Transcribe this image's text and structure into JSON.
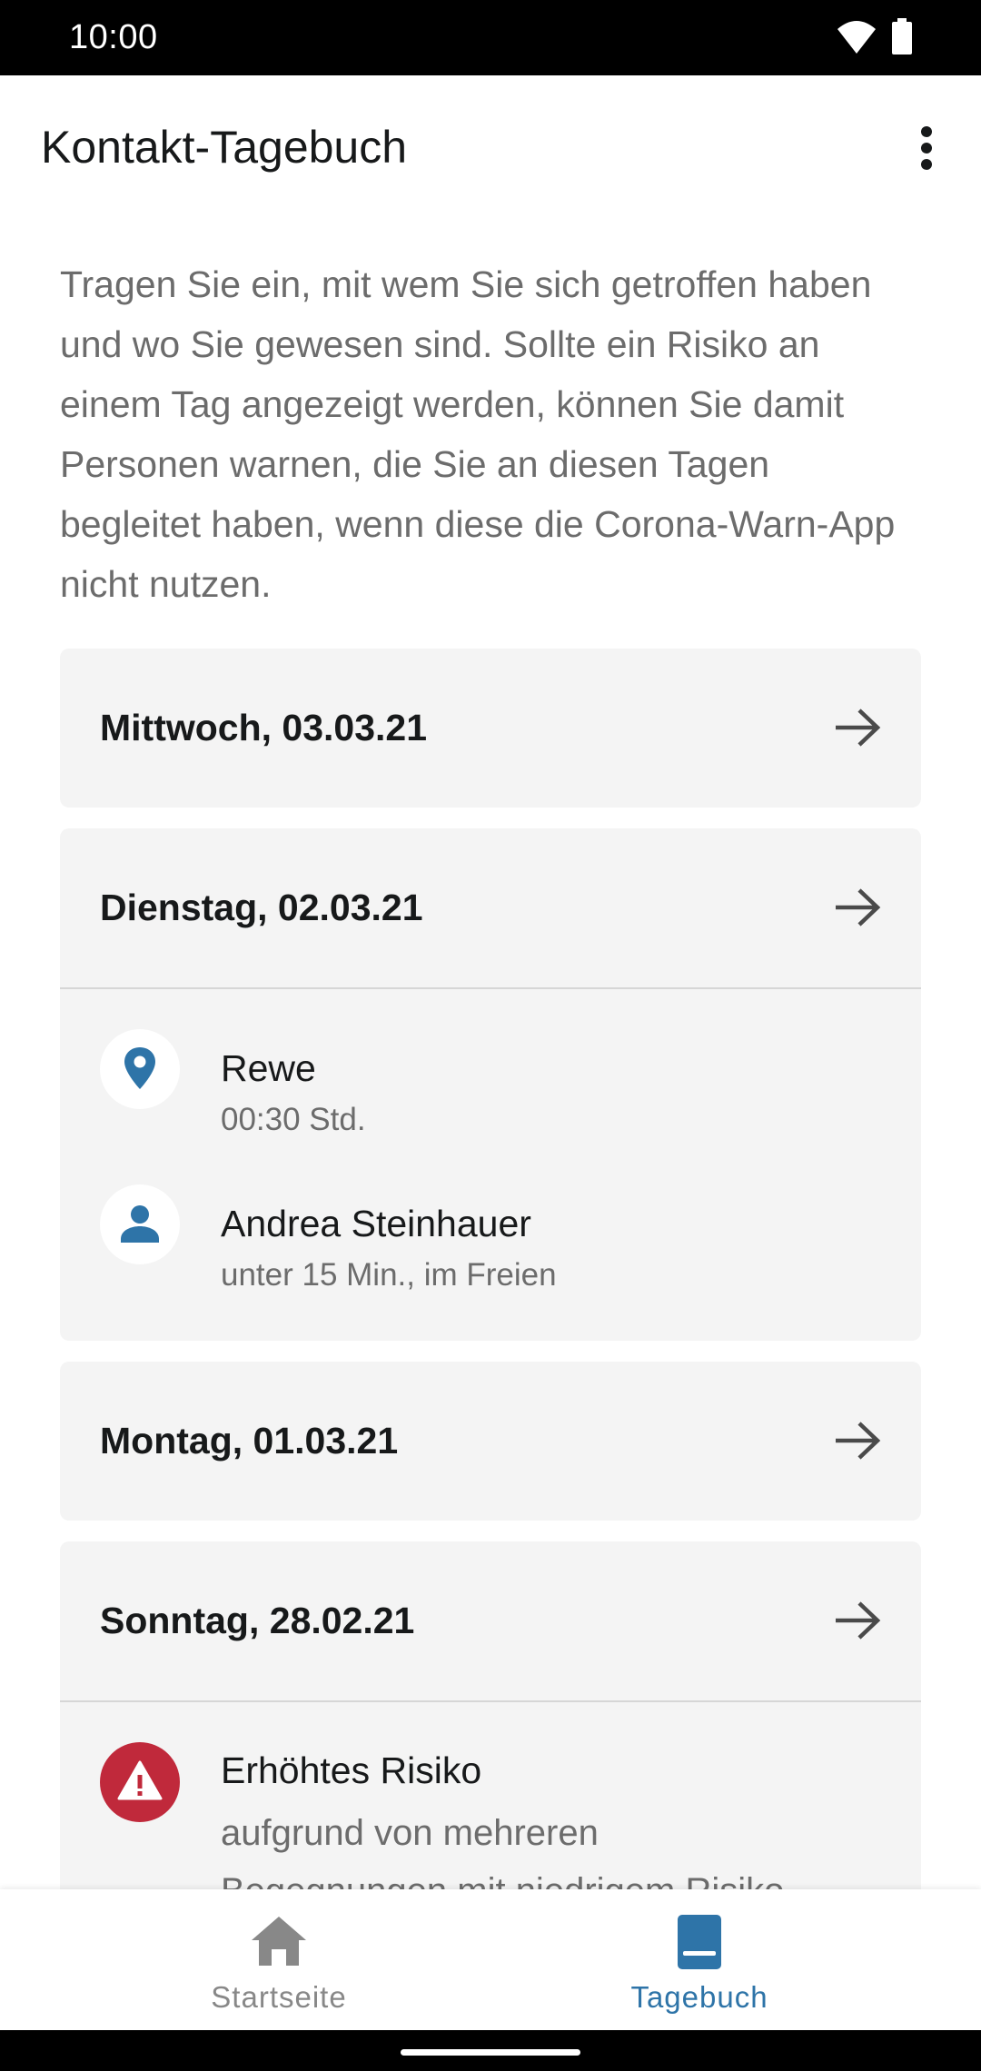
{
  "status_bar": {
    "time": "10:00"
  },
  "app_bar": {
    "title": "Kontakt-Tagebuch"
  },
  "intro_text": "Tragen Sie ein, mit wem Sie sich getroffen haben und wo Sie gewesen sind. Sollte ein Risiko an einem Tag angezeigt werden, können Sie damit Personen warnen, die Sie an diesen Tagen begleitet haben, wenn diese die Corona-Warn-App nicht nutzen.",
  "days": [
    {
      "date": "Mittwoch, 03.03.21"
    },
    {
      "date": "Dienstag, 02.03.21",
      "entries": [
        {
          "icon": "location-pin-icon",
          "name": "Rewe",
          "detail": "00:30 Std."
        },
        {
          "icon": "person-icon",
          "name": "Andrea Steinhauer",
          "detail": "unter 15 Min., im Freien"
        }
      ]
    },
    {
      "date": "Montag, 01.03.21"
    },
    {
      "date": "Sonntag, 28.02.21",
      "risk": {
        "icon": "warning-icon",
        "title": "Erhöhtes Risiko",
        "line1": "aufgrund von mehreren",
        "line2": "Begegnungen mit niedrigem Risiko"
      }
    }
  ],
  "bottom_nav": {
    "items": [
      {
        "label": "Startseite",
        "icon": "home-icon",
        "active": false
      },
      {
        "label": "Tagebuch",
        "icon": "book-icon",
        "active": true
      }
    ]
  },
  "colors": {
    "accent": "#2e74a8",
    "risk_red": "#c0293b",
    "card_bg": "#f4f4f4",
    "inactive_nav": "#888888"
  }
}
